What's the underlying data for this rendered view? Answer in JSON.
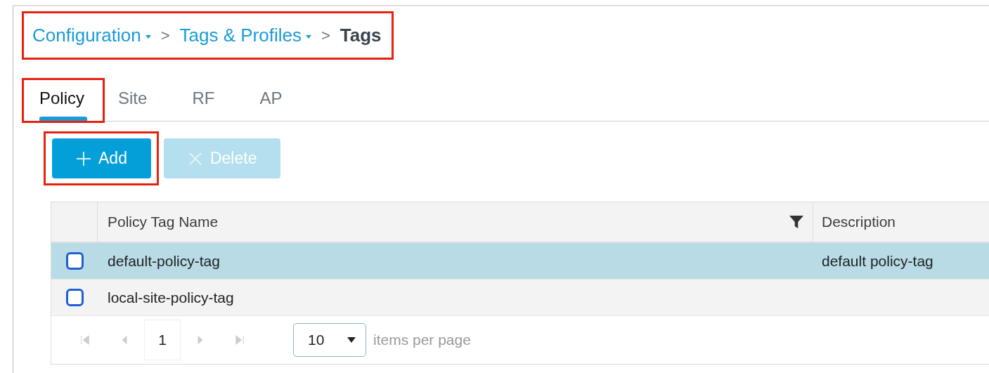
{
  "breadcrumb": {
    "highlighted": true,
    "items": [
      {
        "label": "Configuration",
        "kind": "dropdown"
      },
      {
        "label": "Tags & Profiles",
        "kind": "dropdown"
      },
      {
        "label": "Tags",
        "kind": "current"
      }
    ],
    "separator": ">"
  },
  "tabs": {
    "highlighted": true,
    "items": [
      {
        "label": "Policy",
        "selected": true
      },
      {
        "label": "Site",
        "selected": false
      },
      {
        "label": "RF",
        "selected": false
      },
      {
        "label": "AP",
        "selected": false
      }
    ]
  },
  "toolbar": [
    {
      "label": "Add",
      "kind": "add",
      "disabled": false,
      "highlighted": true
    },
    {
      "label": "Delete",
      "kind": "delete",
      "disabled": true,
      "highlighted": false
    }
  ],
  "table": {
    "columns": [
      {
        "label": "Policy Tag Name",
        "filter": true
      },
      {
        "label": "Description",
        "filter": false
      }
    ],
    "rows": [
      {
        "selected": true,
        "checked": false,
        "cells": [
          "default-policy-tag",
          "default policy-tag"
        ]
      },
      {
        "selected": false,
        "checked": false,
        "cells": [
          "local-site-policy-tag",
          ""
        ]
      }
    ]
  },
  "pager": {
    "page": "1",
    "page_size": "10",
    "suffix": "items per page"
  }
}
